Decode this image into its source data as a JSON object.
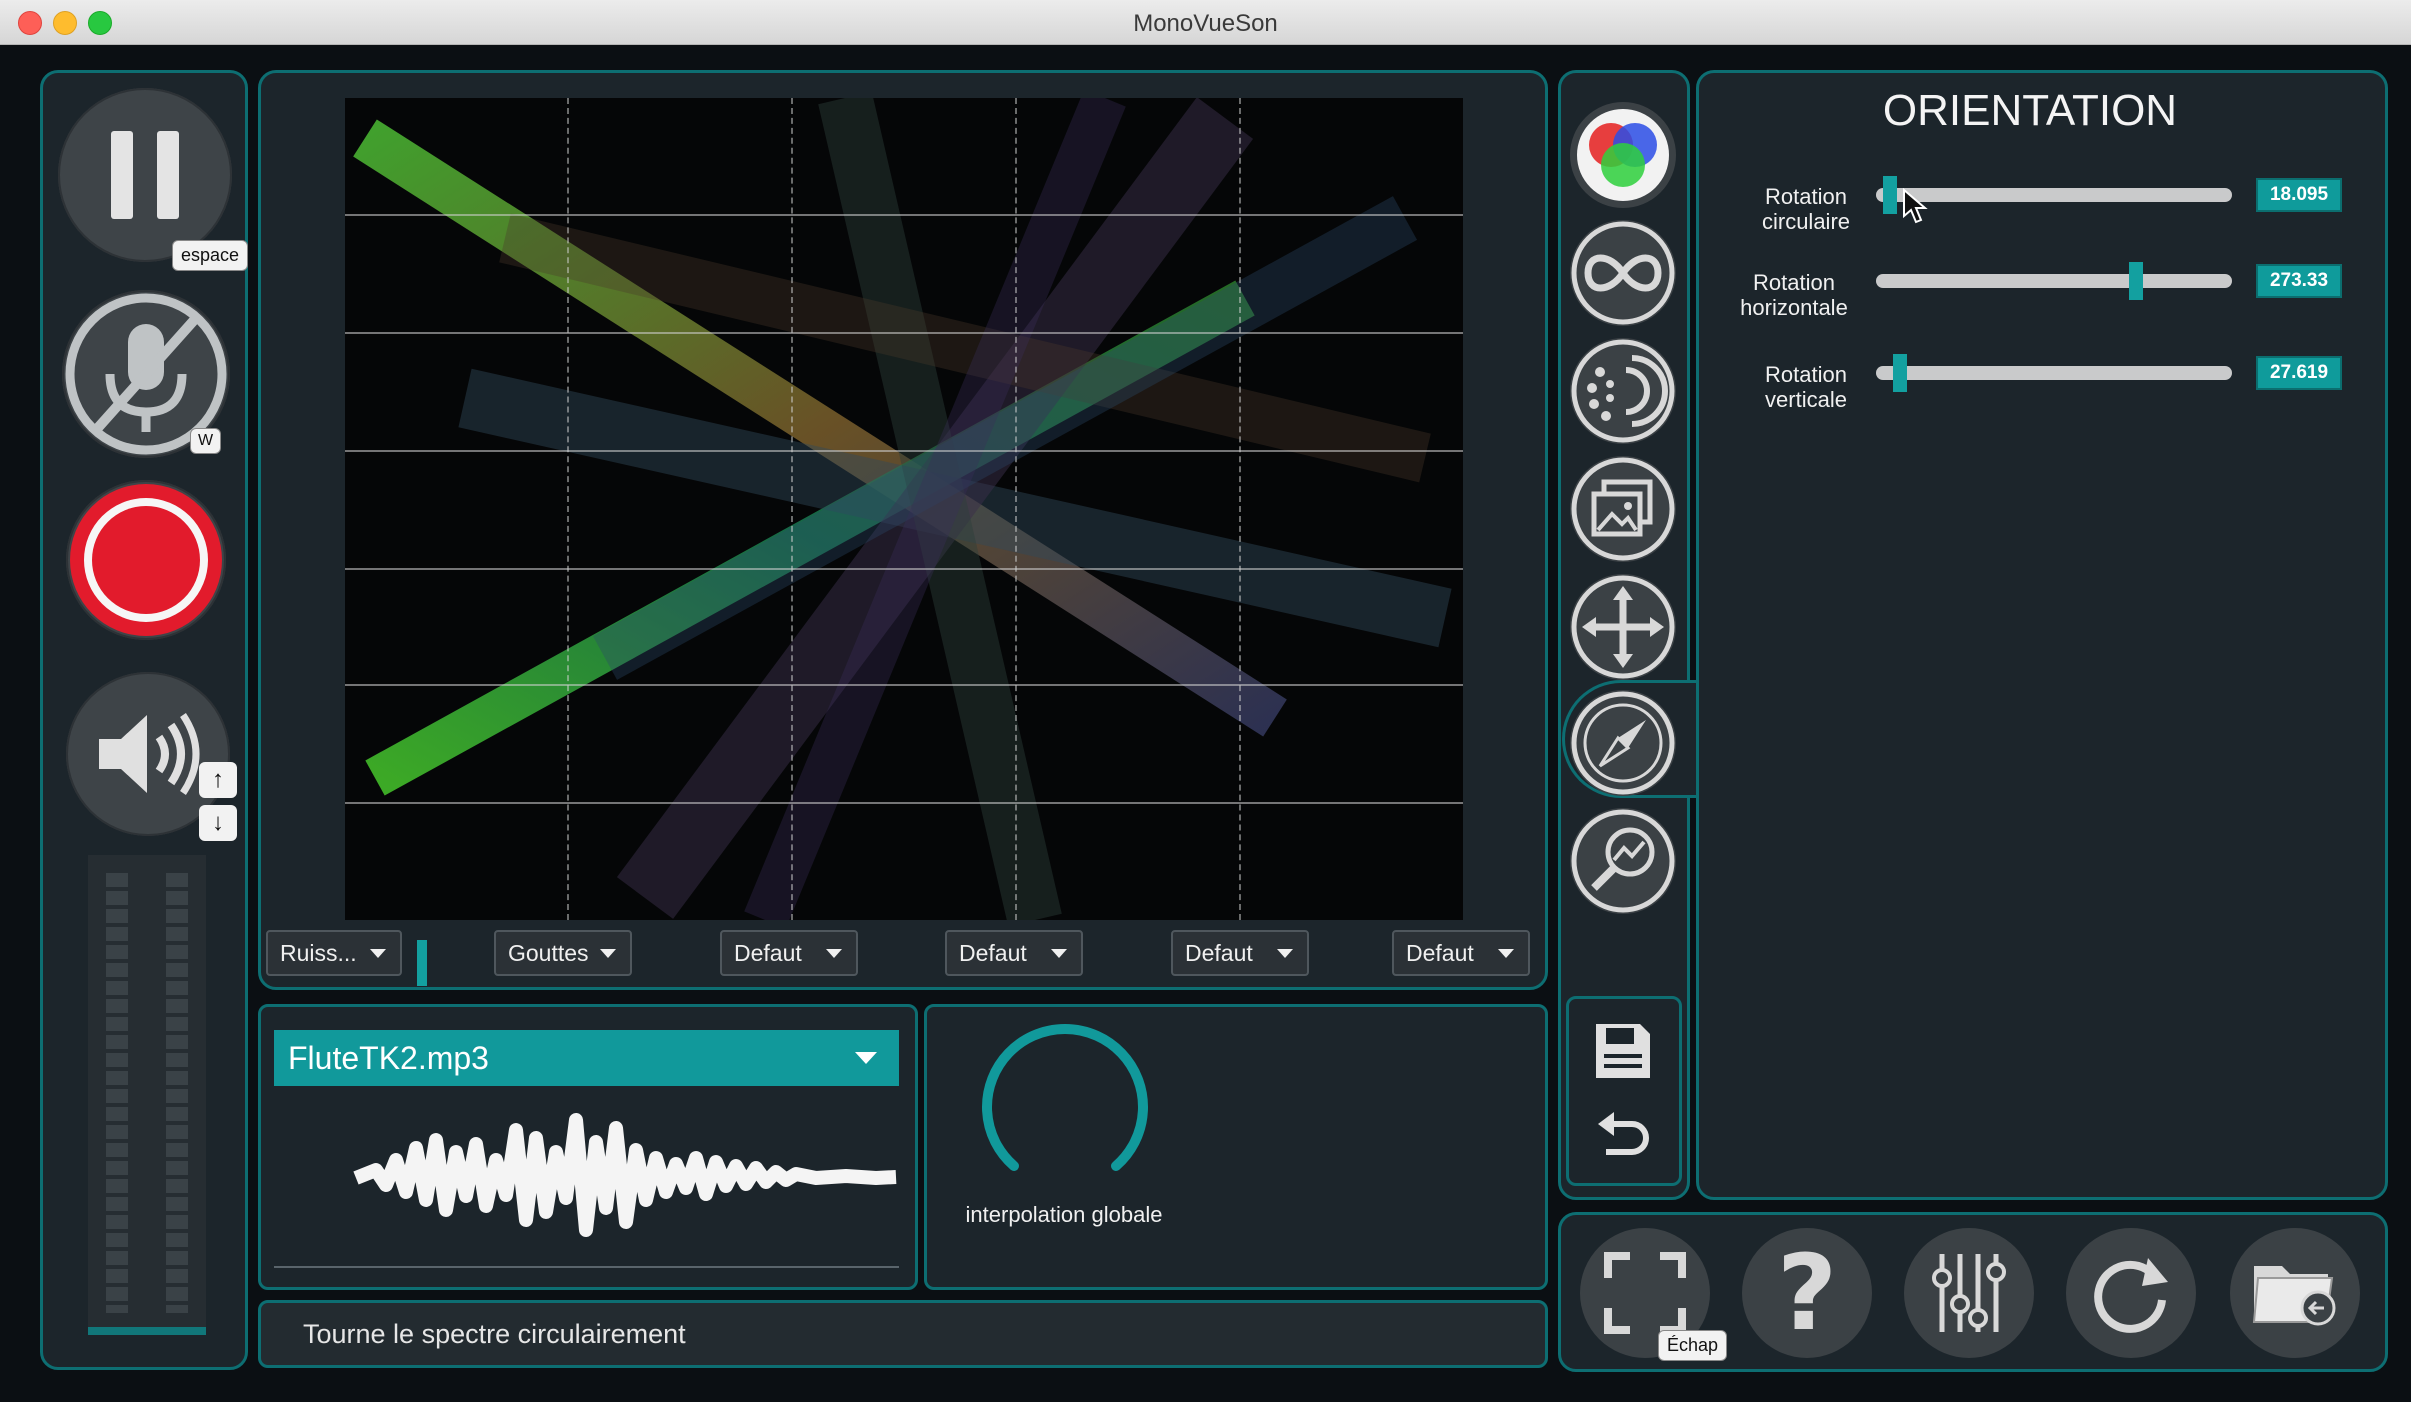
{
  "window": {
    "title": "MonoVueSon"
  },
  "transport": {
    "pause_key": "espace",
    "mic_key": "W",
    "volume_up_key": "↑",
    "volume_down_key": "↓"
  },
  "visualization": {
    "channel_dropdowns": [
      {
        "value": "Ruiss..."
      },
      {
        "value": "Gouttes"
      },
      {
        "value": "Defaut"
      },
      {
        "value": "Defaut"
      },
      {
        "value": "Defaut"
      },
      {
        "value": "Defaut"
      }
    ]
  },
  "file": {
    "selected": "FluteTK2.mp3"
  },
  "interpolation": {
    "label": "interpolation globale"
  },
  "status": {
    "text": "Tourne le spectre circulairement"
  },
  "orientation": {
    "title": "ORIENTATION",
    "sliders": [
      {
        "label_line1": "Rotation",
        "label_line2": "circulaire",
        "value": "18.095",
        "fraction": 0.02
      },
      {
        "label_line1": "Rotation",
        "label_line2": "horizontale",
        "value": "273.33",
        "fraction": 0.74
      },
      {
        "label_line1": "Rotation",
        "label_line2": "verticale",
        "value": "27.619",
        "fraction": 0.05
      }
    ]
  },
  "bottom_bar": {
    "fullscreen_key": "Échap"
  },
  "colors": {
    "accent": "#11999b",
    "record": "#e21b2c",
    "panel": "#1c252b"
  }
}
